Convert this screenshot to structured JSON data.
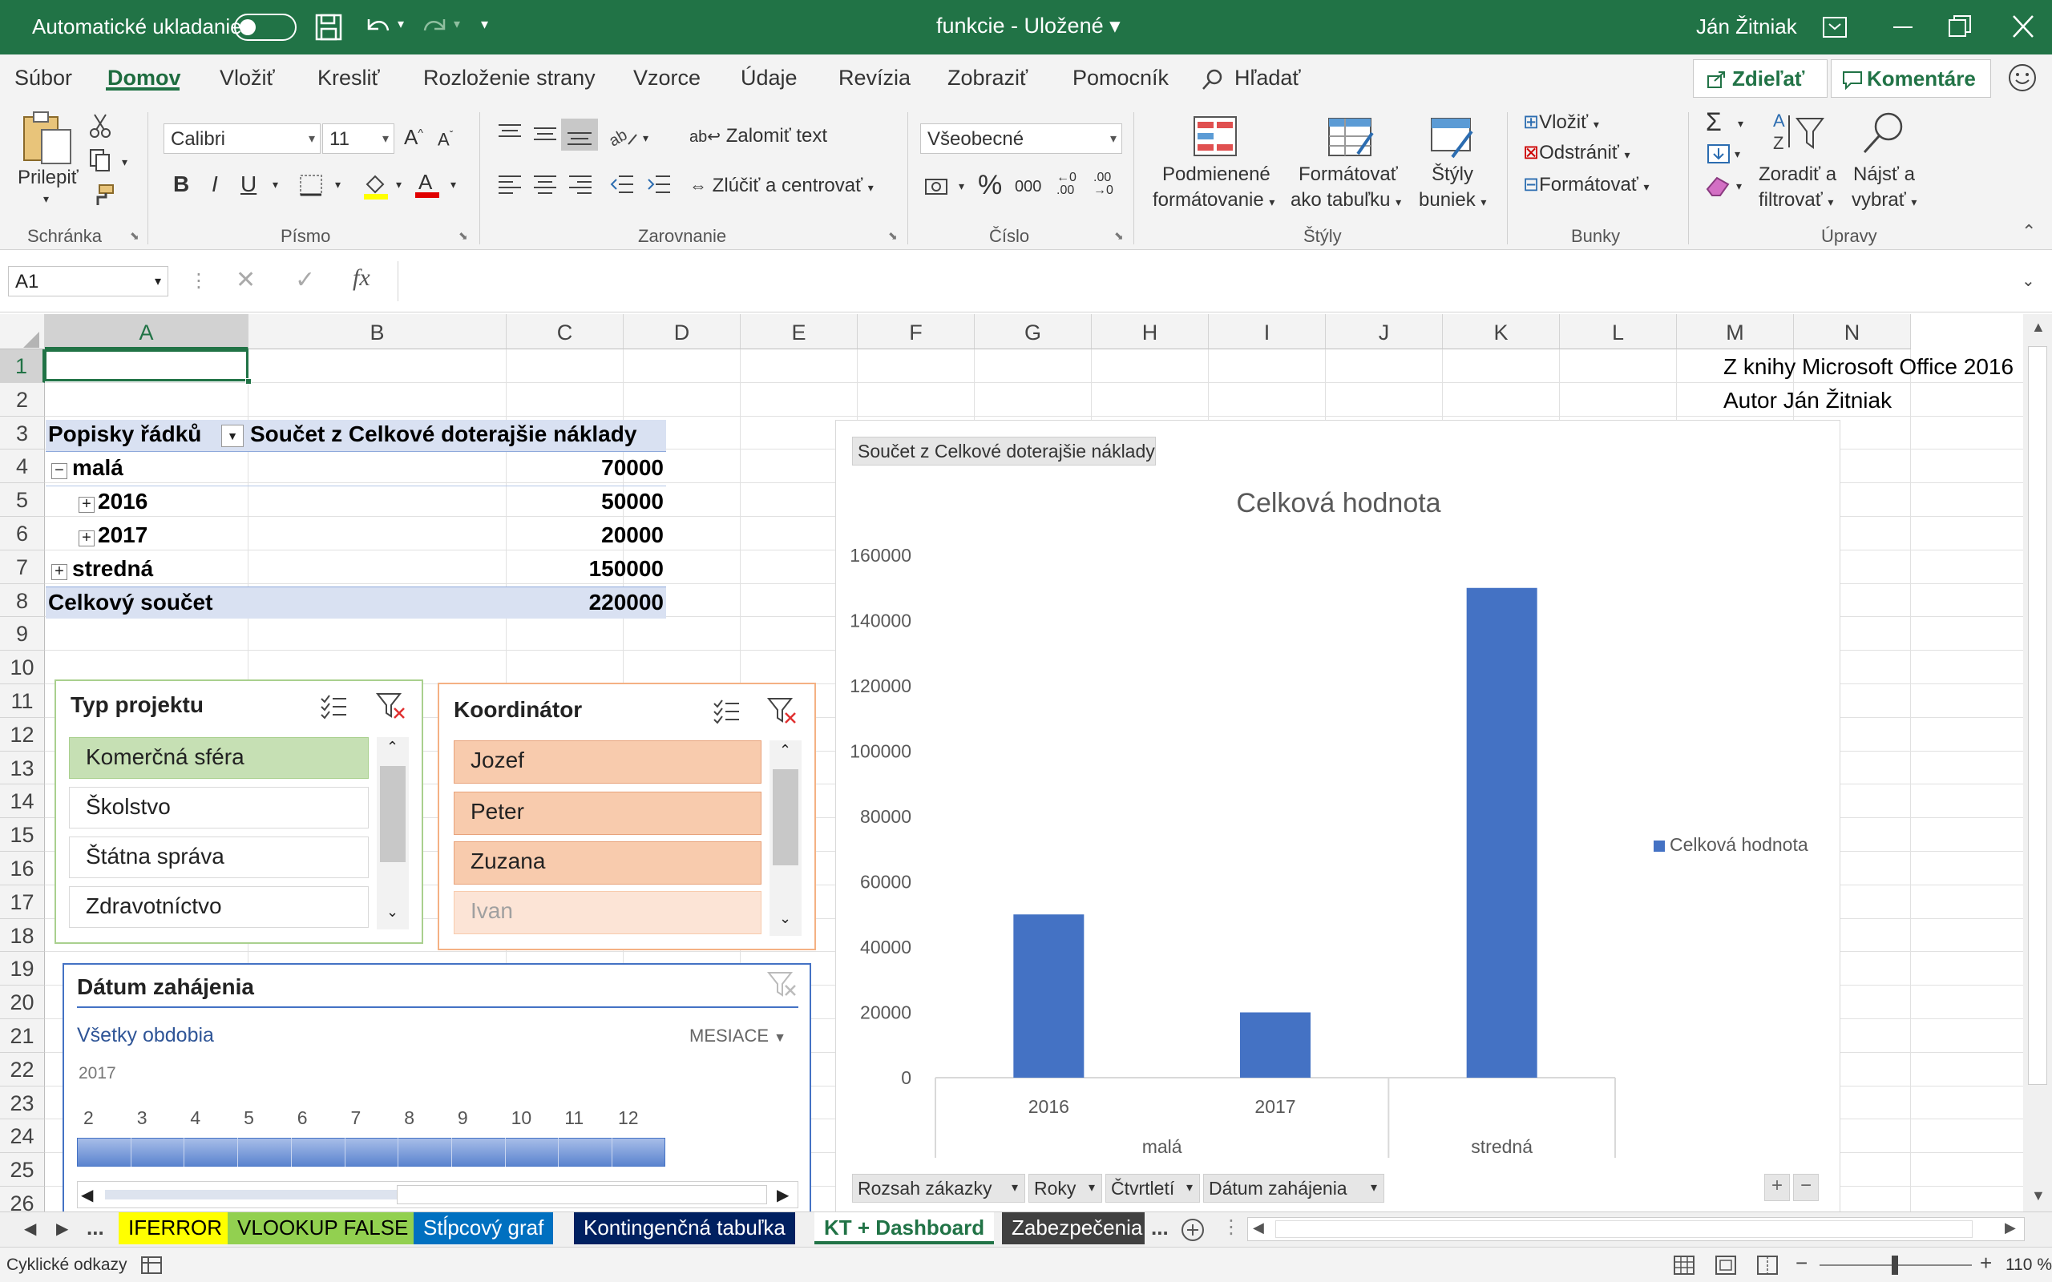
{
  "titlebar": {
    "autosave_label": "Automatické ukladanie",
    "doc_title": "funkcie - Uložené",
    "user": "Ján Žitniak"
  },
  "menu": {
    "items": [
      "Súbor",
      "Domov",
      "Vložiť",
      "Kresliť",
      "Rozloženie strany",
      "Vzorce",
      "Údaje",
      "Revízia",
      "Zobraziť",
      "Pomocník"
    ],
    "search": "Hľadať",
    "share": "Zdieľať",
    "comments": "Komentáre"
  },
  "ribbon": {
    "paste": "Prilepiť",
    "font_name": "Calibri",
    "font_size": "11",
    "wrap_text": "Zalomiť text",
    "merge_center": "Zlúčiť a centrovať",
    "number_format": "Všeobecné",
    "cond_format_1": "Podmienené",
    "cond_format_2": "formátovanie",
    "format_table_1": "Formátovať",
    "format_table_2": "ako tabuľku",
    "cell_styles_1": "Štýly",
    "cell_styles_2": "buniek",
    "insert": "Vložiť",
    "delete": "Odstrániť",
    "format": "Formátovať",
    "sort_1": "Zoradiť a",
    "sort_2": "filtrovať",
    "find_1": "Nájsť a",
    "find_2": "vybrať",
    "groups": {
      "clipboard": "Schránka",
      "font": "Písmo",
      "alignment": "Zarovnanie",
      "number": "Číslo",
      "styles": "Štýly",
      "cells": "Bunky",
      "editing": "Úpravy"
    }
  },
  "formula": {
    "name_box": "A1",
    "value": ""
  },
  "grid": {
    "columns": [
      "A",
      "B",
      "C",
      "D",
      "E",
      "F",
      "G",
      "H",
      "I",
      "J",
      "K",
      "L",
      "M",
      "N"
    ],
    "rows": [
      "1",
      "2",
      "3",
      "4",
      "5",
      "6",
      "7",
      "8",
      "9",
      "10",
      "11",
      "12",
      "13",
      "14",
      "15",
      "16",
      "17",
      "18",
      "19",
      "20",
      "21",
      "22",
      "23",
      "24",
      "25",
      "26"
    ],
    "note_1": "Z knihy Microsoft Office 2016",
    "note_2": "Autor Ján Žitniak"
  },
  "pivot": {
    "row_labels": "Popisky řádků",
    "value_header": "Součet z Celkové doterajšie náklady",
    "rows": [
      {
        "label": "malá",
        "value": "70000"
      },
      {
        "label": "2016",
        "value": "50000"
      },
      {
        "label": "2017",
        "value": "20000"
      },
      {
        "label": "stredná",
        "value": "150000"
      }
    ],
    "total_label": "Celkový součet",
    "total_value": "220000"
  },
  "slicer_typ": {
    "title": "Typ projektu",
    "items": [
      "Komerčná sféra",
      "Školstvo",
      "Štátna správa",
      "Zdravotníctvo"
    ]
  },
  "slicer_koord": {
    "title": "Koordinátor",
    "items": [
      "Jozef",
      "Peter",
      "Zuzana",
      "Ivan"
    ]
  },
  "timeline": {
    "title": "Dátum zahájenia",
    "all_periods": "Všetky obdobia",
    "level": "MESIACE",
    "year": "2017",
    "months": [
      "2",
      "3",
      "4",
      "5",
      "6",
      "7",
      "8",
      "9",
      "10",
      "11",
      "12"
    ]
  },
  "chart_data": {
    "type": "bar",
    "title": "Celková hodnota",
    "value_field": "Součet z Celkové doterajšie náklady",
    "categories": [
      "2016",
      "2017",
      "stredná"
    ],
    "category_groups": [
      {
        "label": "malá",
        "span": 2
      },
      {
        "label": "stredná",
        "span": 1
      }
    ],
    "series": [
      {
        "name": "Celková hodnota",
        "values": [
          50000,
          20000,
          150000
        ],
        "color": "#4472c4"
      }
    ],
    "ylim": [
      0,
      160000
    ],
    "yticks": [
      "0",
      "20000",
      "40000",
      "60000",
      "80000",
      "100000",
      "120000",
      "140000",
      "160000"
    ],
    "legend": "right",
    "grid": false,
    "field_buttons": [
      "Rozsah zákazky",
      "Roky",
      "Čtvrtletí",
      "Dátum zahájenia"
    ]
  },
  "sheets": [
    "IFERROR",
    "VLOOKUP FALSE",
    "Stĺpcový graf",
    "Kontingenčná tabuľka",
    "KT + Dashboard",
    "Zabezpečenia"
  ],
  "ellipsis": "...",
  "status": {
    "left": "Cyklické odkazy",
    "zoom": "110 %"
  },
  "colors": {
    "excel_green": "#217346",
    "bar_blue": "#4472c4",
    "slicer_green": "#c6e0b4",
    "slicer_orange": "#f8cbad"
  }
}
